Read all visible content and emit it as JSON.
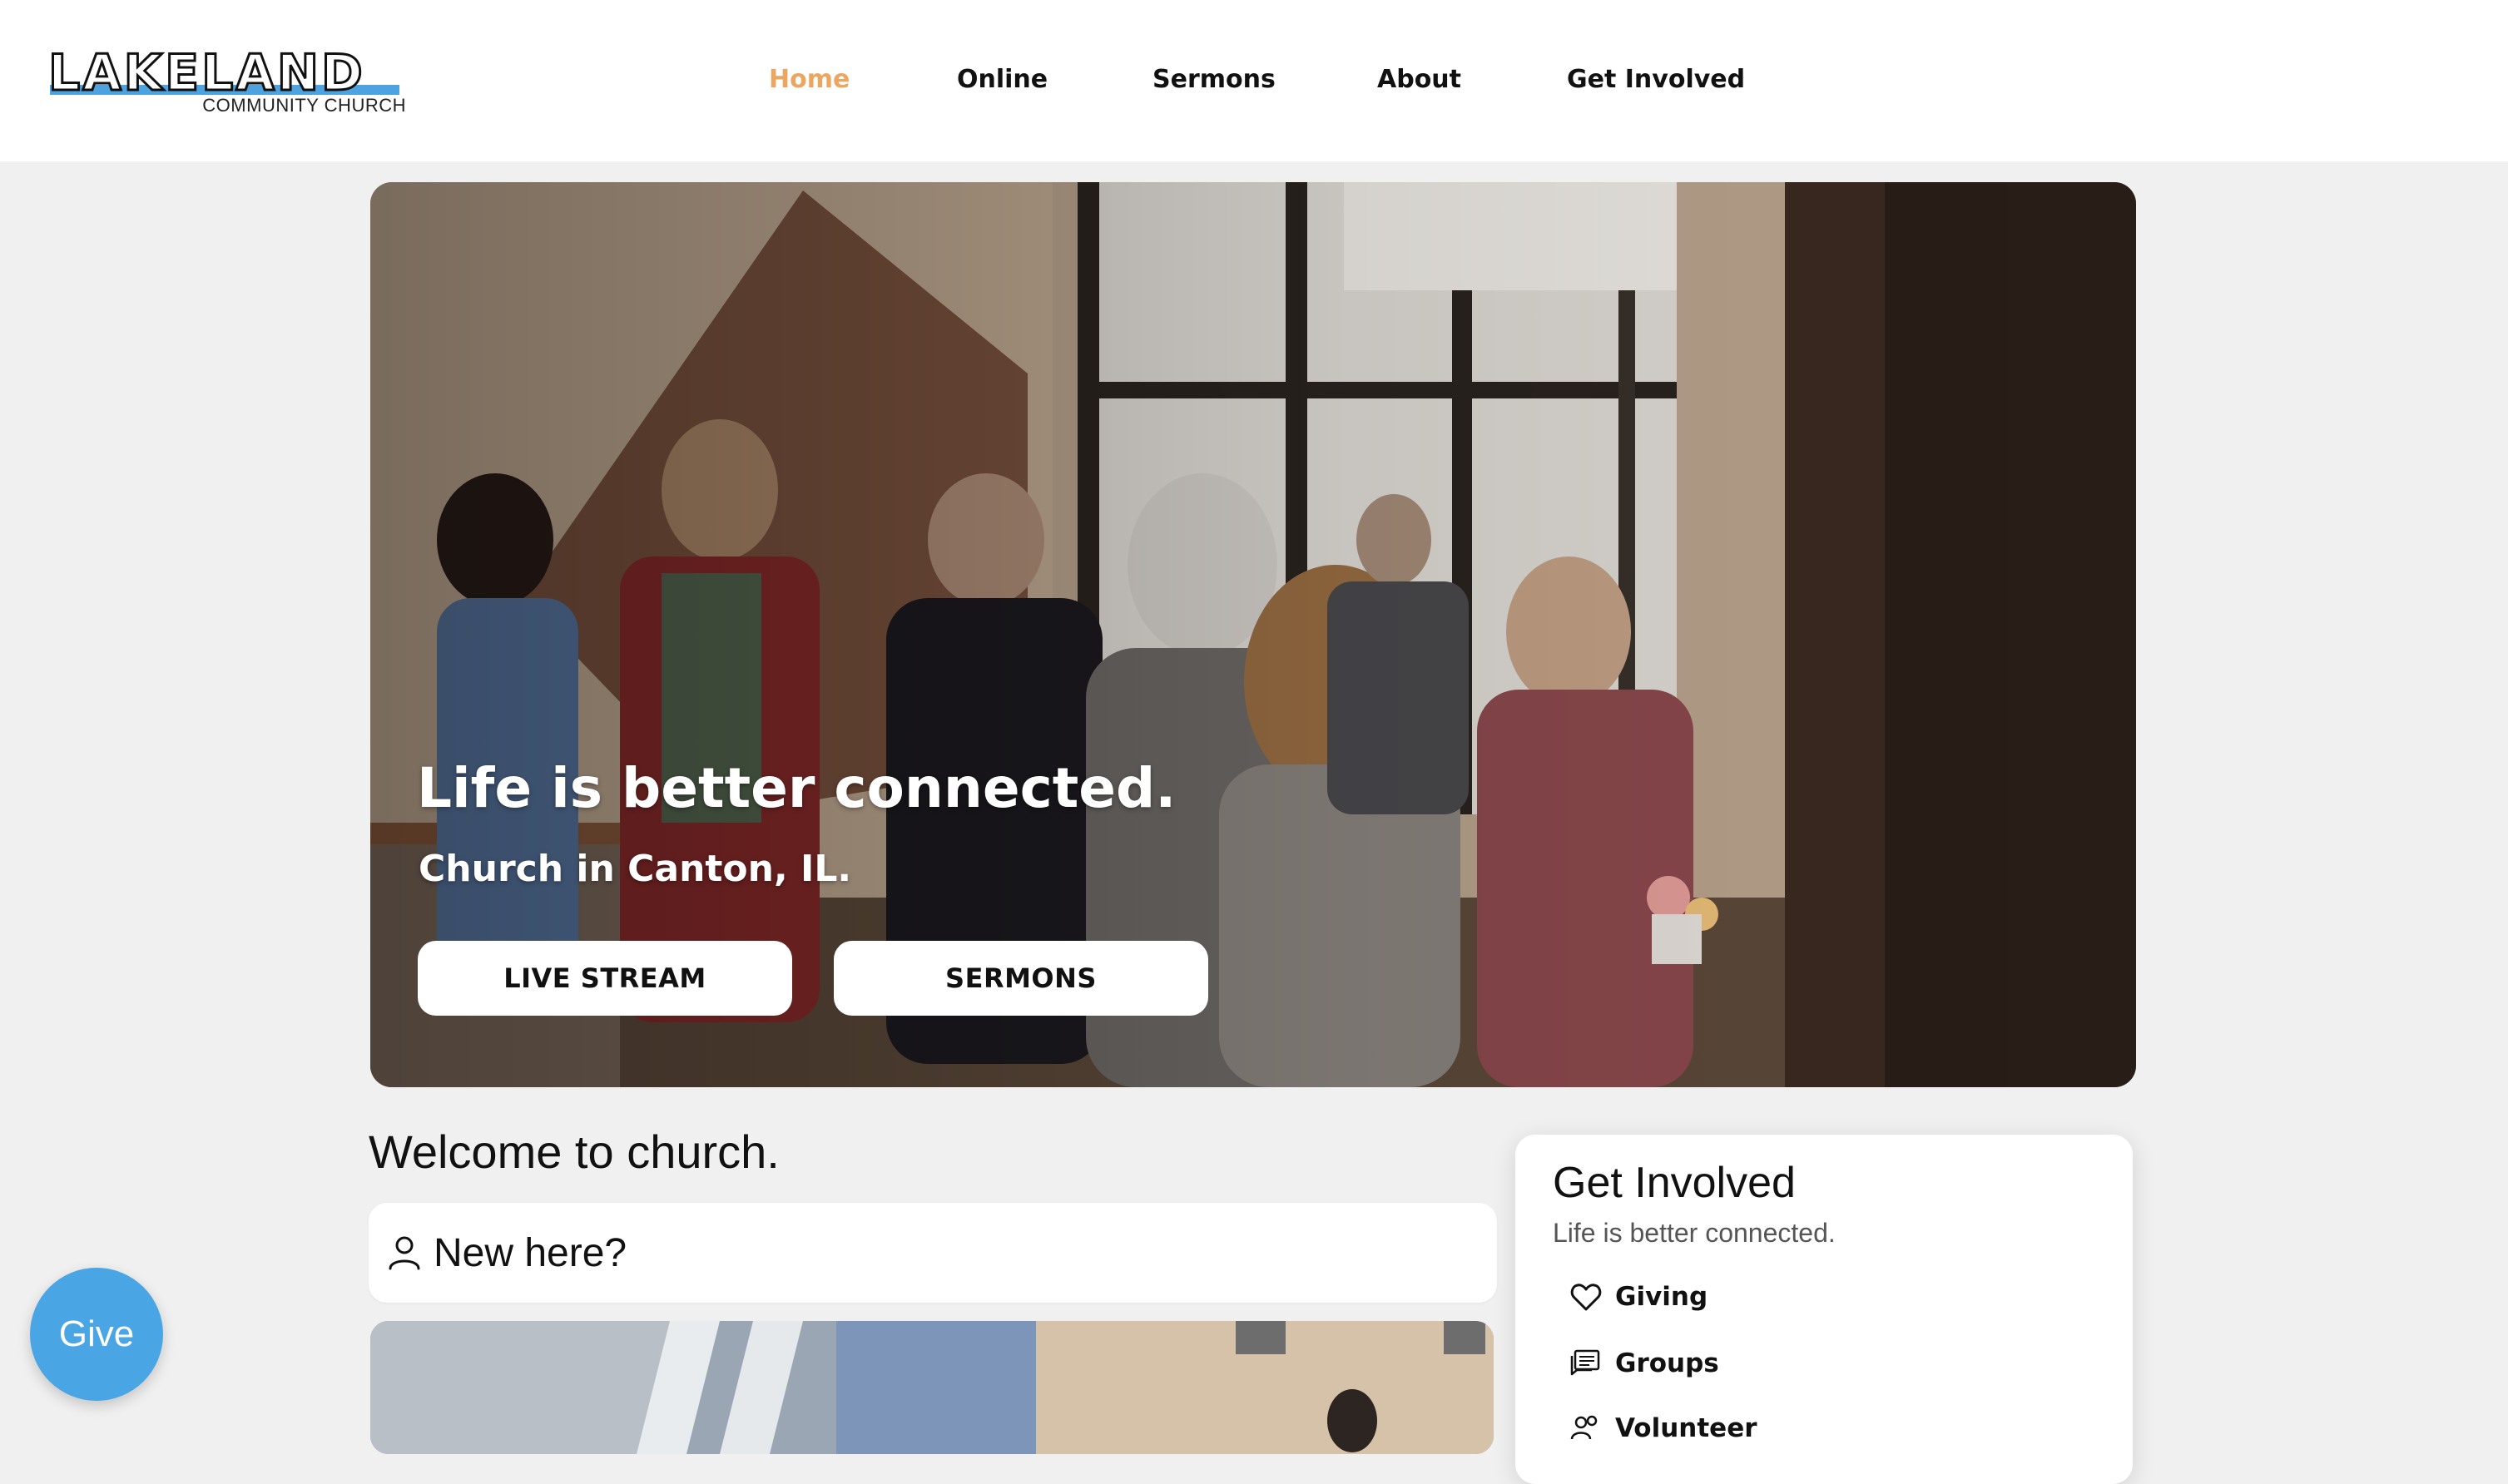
{
  "logo": {
    "wordmark": "LAKELAND",
    "subtitle": "COMMUNITY CHURCH",
    "accent_color": "#4da3e0"
  },
  "nav": {
    "items": [
      {
        "label": "Home",
        "active": true
      },
      {
        "label": "Online",
        "active": false
      },
      {
        "label": "Sermons",
        "active": false
      },
      {
        "label": "About",
        "active": false
      },
      {
        "label": "Get Involved",
        "active": false
      }
    ],
    "active_color": "#eda660"
  },
  "hero": {
    "title": "Life is better connected.",
    "subtitle": "Church in Canton, IL.",
    "buttons": {
      "live_stream": "LIVE STREAM",
      "sermons": "SERMONS"
    }
  },
  "welcome": {
    "title": "Welcome to church.",
    "new_here_label": "New here?",
    "new_here_icon": "user-icon"
  },
  "get_involved": {
    "title": "Get Involved",
    "subtitle": "Life is better connected.",
    "items": [
      {
        "label": "Giving",
        "icon": "heart-icon"
      },
      {
        "label": "Groups",
        "icon": "chat-icon"
      },
      {
        "label": "Volunteer",
        "icon": "people-icon"
      }
    ]
  },
  "give_button": {
    "label": "Give",
    "color": "#4aa5e4"
  }
}
